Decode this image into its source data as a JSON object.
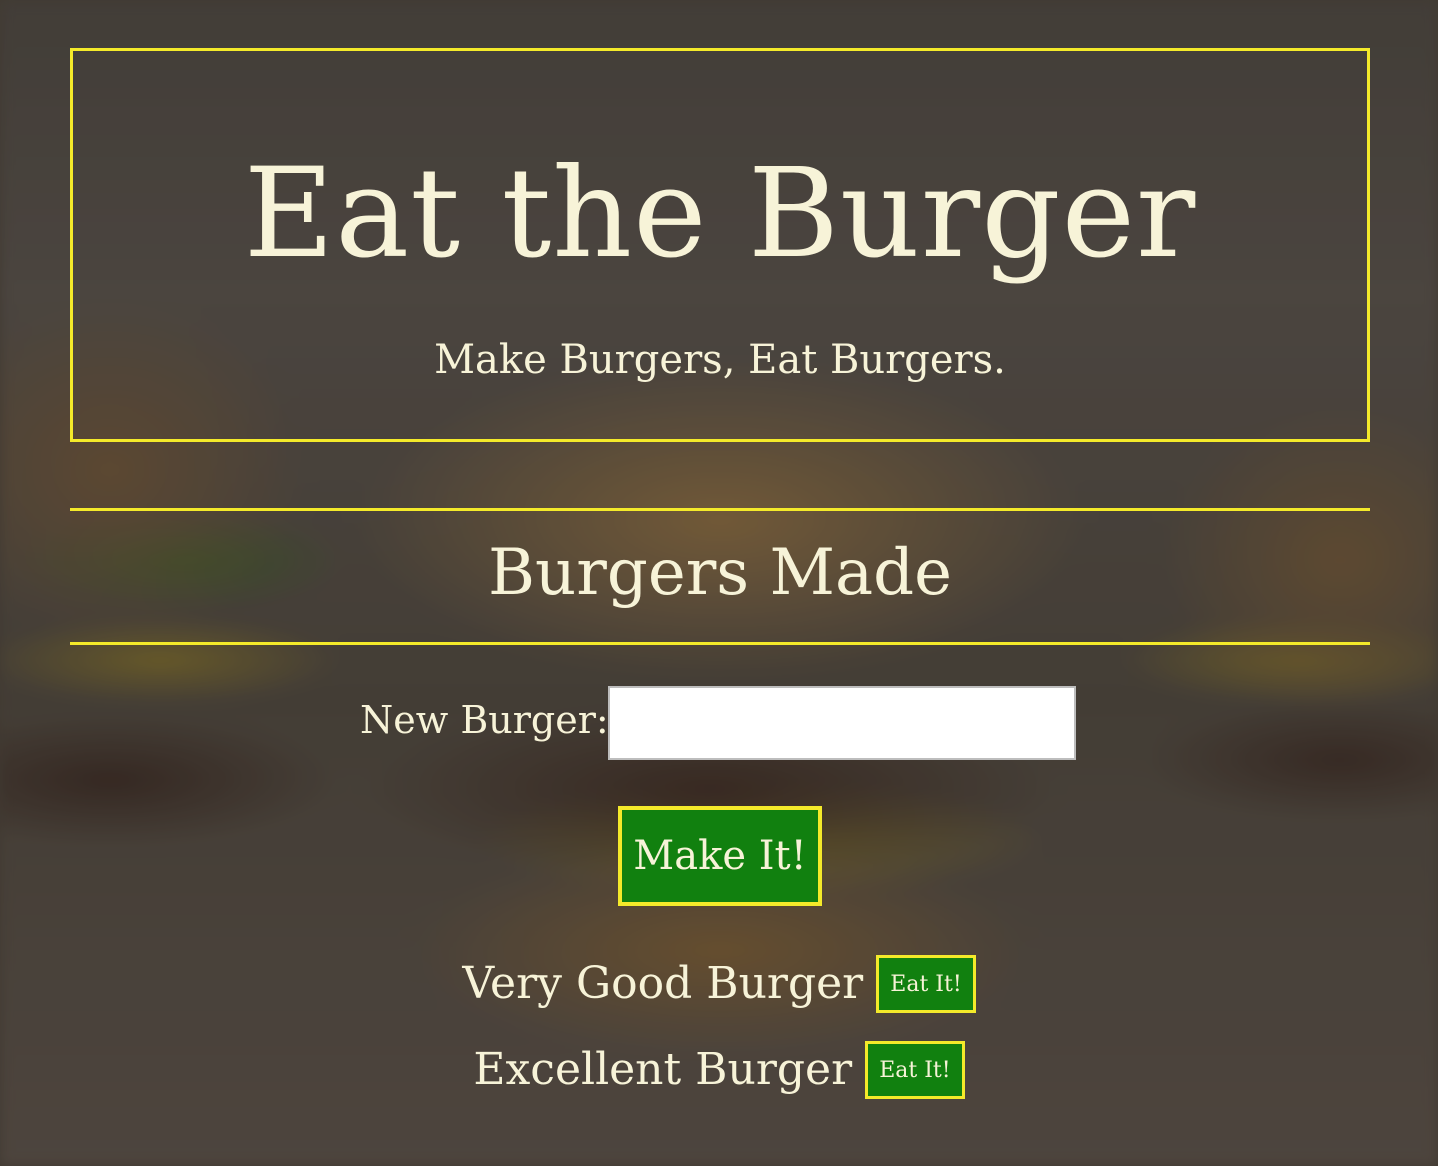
{
  "header": {
    "title": "Eat the Burger",
    "subtitle": "Make Burgers, Eat Burgers."
  },
  "section": {
    "title": "Burgers Made"
  },
  "form": {
    "label": "New Burger:",
    "input_value": "",
    "input_placeholder": "",
    "submit_label": "Make It!"
  },
  "burgers": [
    {
      "name": "Very Good Burger",
      "button_label": "Eat It!"
    },
    {
      "name": "Excellent Burger",
      "button_label": "Eat It!"
    }
  ],
  "colors": {
    "accent_border": "#f4ea2a",
    "button_bg": "#11800f",
    "text": "#f7f3d8"
  }
}
